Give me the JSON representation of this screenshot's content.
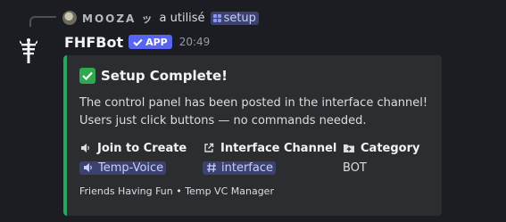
{
  "reply": {
    "username": "MOOZA ッ",
    "action": "a utilisé",
    "command": "setup"
  },
  "message": {
    "bot_name": "FHFBot",
    "badge": "APP",
    "timestamp": "20:49"
  },
  "embed": {
    "accent_color": "#23a55a",
    "title": "Setup Complete!",
    "description_line1": "The control panel has been posted in the interface channel!",
    "description_line2": "Users just click buttons — no commands needed.",
    "fields": [
      {
        "name": "Join to Create",
        "icon": "speaker-icon",
        "value": "Temp-Voice",
        "value_icon": "speaker-icon"
      },
      {
        "name": "Interface Channel",
        "icon": "external-link-icon",
        "value": "interface",
        "value_icon": "hash-icon"
      },
      {
        "name": "Category",
        "icon": "folder-plus-icon",
        "value": "BOT"
      }
    ],
    "footer": "Friends Having Fun • Temp VC Manager"
  }
}
